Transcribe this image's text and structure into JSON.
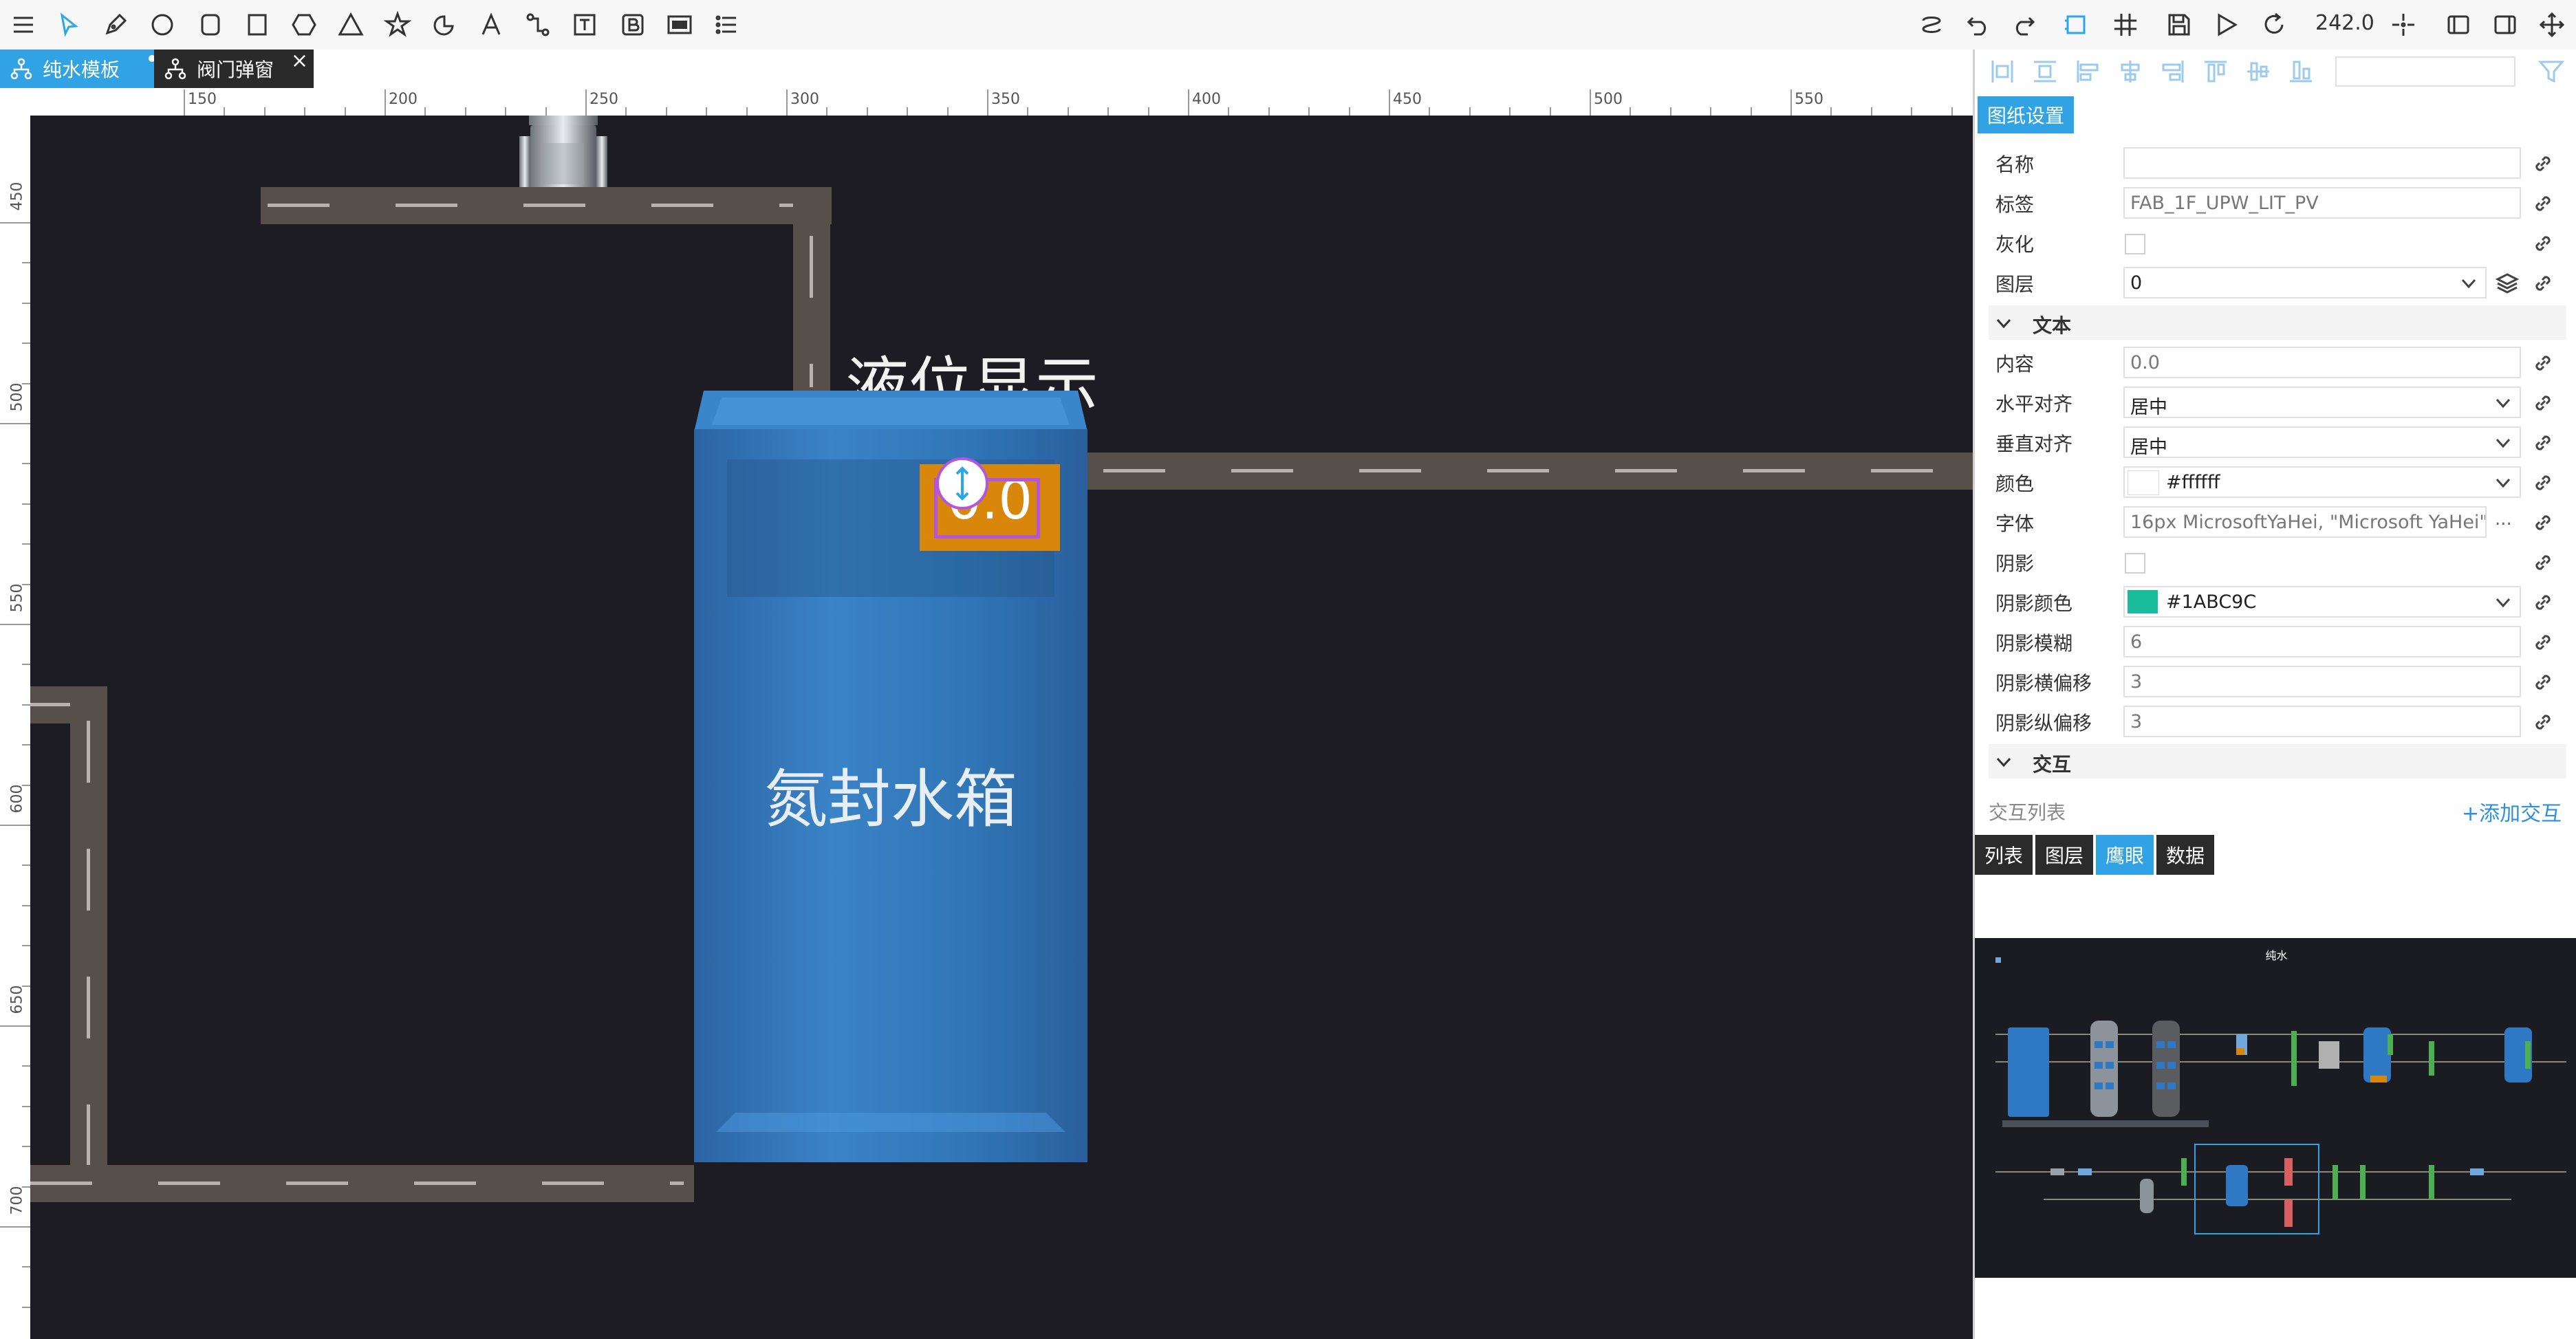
{
  "toolbar": {
    "zoom": "242.0"
  },
  "tabs": [
    {
      "label": "纯水模板",
      "modified": true
    },
    {
      "label": "阀门弹窗"
    }
  ],
  "ruler": {
    "horizontal": [
      "150",
      "200",
      "250",
      "300",
      "350",
      "400",
      "450",
      "500",
      "550"
    ],
    "vertical": [
      "450",
      "500",
      "550",
      "600",
      "650",
      "700"
    ]
  },
  "canvas": {
    "tank_label": "液位显示",
    "tank_name": "氮封水箱",
    "level_value": "0.0"
  },
  "panel": {
    "settings_tab": "图纸设置",
    "props": {
      "name_label": "名称",
      "name_value": "",
      "tag_label": "标签",
      "tag_value": "FAB_1F_UPW_LIT_PV",
      "gray_label": "灰化",
      "layer_label": "图层",
      "layer_value": "0"
    },
    "text_section": {
      "title": "文本",
      "content_label": "内容",
      "content_value": "0.0",
      "halign_label": "水平对齐",
      "halign_value": "居中",
      "valign_label": "垂直对齐",
      "valign_value": "居中",
      "color_label": "颜色",
      "color_value": "#ffffff",
      "font_label": "字体",
      "font_value": "16px MicrosoftYaHei, \"Microsoft YaHei\"",
      "font_more": "...",
      "shadow_label": "阴影",
      "shadow_color_label": "阴影颜色",
      "shadow_color_value": "#1ABC9C",
      "shadow_blur_label": "阴影模糊",
      "shadow_blur_value": "6",
      "shadow_x_label": "阴影横偏移",
      "shadow_x_value": "3",
      "shadow_y_label": "阴影纵偏移",
      "shadow_y_value": "3"
    },
    "interaction_section": {
      "title": "交互",
      "list_label": "交互列表",
      "add_label": "+添加交互"
    },
    "bottom_tabs": [
      "列表",
      "图层",
      "鹰眼",
      "数据"
    ],
    "active_bottom_tab": "鹰眼",
    "overview_title": "纯水"
  },
  "colors": {
    "accent": "#31a3e4",
    "canvas_bg": "#1d1c23",
    "pipe": "#574f4a",
    "tank": "#2f6fae",
    "level_box": "#d8870a",
    "selection": "#b455e0",
    "shadow_swatch": "#1ABC9C"
  }
}
